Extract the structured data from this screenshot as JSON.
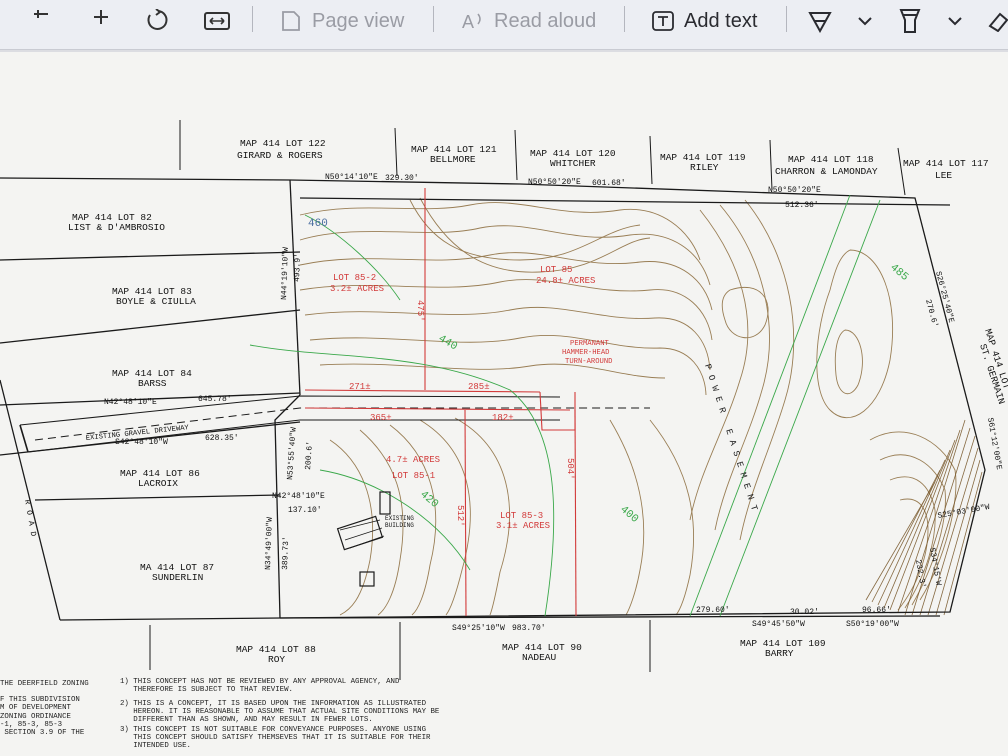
{
  "toolbar": {
    "page_view": "Page view",
    "read_aloud": "Read aloud",
    "add_text": "Add text"
  },
  "plan": {
    "adjacent": {
      "lot122": "MAP 414 LOT 122",
      "lot122_owner": "GIRARD & ROGERS",
      "lot121": "MAP 414 LOT 121",
      "lot121_owner": "BELLMORE",
      "lot120": "MAP 414 LOT 120",
      "lot120_owner": "WHITCHER",
      "lot119": "MAP 414 LOT 119",
      "lot119_owner": "RILEY",
      "lot118": "MAP 414 LOT 118",
      "lot118_owner": "CHARRON & LAMONDAY",
      "lot117": "MAP 414 LOT 117",
      "lot117_owner": "LEE",
      "lot82": "MAP 414 LOT 82",
      "lot82_owner": "LIST & D'AMBROSIO",
      "lot83": "MAP 414 LOT 83",
      "lot83_owner": "BOYLE & CIULLA",
      "lot84": "MAP 414 LOT 84",
      "lot84_owner": "BARSS",
      "lot86": "MAP 414 LOT 86",
      "lot86_owner": "LACROIX",
      "lot87": "MA 414 LOT 87",
      "lot87_owner": "SUNDERLIN",
      "lot88": "MAP 414 LOT 88",
      "lot88_owner": "ROY",
      "lot90": "MAP 414 LOT 90",
      "lot90_owner": "NADEAU",
      "lot109": "MAP 414 LOT 109",
      "lot109_owner": "BARRY",
      "right_lot": "MAP 414 LOT",
      "right_owner": "ST. GERMAIN"
    },
    "bearings": {
      "top1": "N50°14'10\"E",
      "top1_dist": "329.30'",
      "top2": "N50°50'20\"E",
      "top2_dist": "601.68'",
      "top3": "N50°50'20\"E",
      "top3_dist": "512.36'",
      "left_top": "N44°19'10\"W",
      "left_top_dist": "493.9'",
      "drive_n": "N42°48'10\"E",
      "drive_n_dist": "645.78'",
      "drive_s": "S42°48'10\"W",
      "drive_s_dist": "628.35'",
      "left_mid": "N53°55'40\"W",
      "left_mid_dist": "200.6'",
      "lot86_b": "N42°48'10\"E",
      "lot86_d": "137.10'",
      "left_low": "N34°49'00\"W",
      "left_low_dist": "389.73'",
      "bottom1": "S49°25'10\"W",
      "bottom1_dist": "983.70'",
      "bottom2": "S49°45'50\"W",
      "bottom2_dist": "279.60'",
      "bottom3": "S50°19'00\"W",
      "right1": "S26°25'40\"E",
      "right1_dist": "270.6'",
      "right2": "S61°12'00\"E",
      "right3": "S25°03'00\"W",
      "right4": "S34°15'W",
      "right4_dist": "232.3'",
      "bottom_small": "30.02'",
      "bottom_small2": "96.66'"
    },
    "lots": {
      "lot85_2": "LOT 85-2",
      "lot85_2_area": "3.2± ACRES",
      "lot85": "LOT 85",
      "lot85_area": "24.8± ACRES",
      "lot85_1": "LOT 85-1",
      "lot85_1_area": "4.7± ACRES",
      "lot85_3": "LOT 85-3",
      "lot85_3_area": "3.1± ACRES",
      "turnaround": "PERMANANT\nHAMMER-HEAD\nTURN-AROUND",
      "frontage1": "271±",
      "frontage2": "285±",
      "frontage3": "365±",
      "frontage4": "182±",
      "depth1": "475'",
      "depth2": "512'",
      "depth3": "504'"
    },
    "labels": {
      "driveway": "EXISTING GRAVEL DRIVEWAY",
      "building": "EXISTING\nBUILDING",
      "easement": "POWER EASEMENT",
      "road": "ROAD",
      "contour_460": "460",
      "contour_440": "440",
      "contour_420": "420",
      "contour_400": "400",
      "contour_485": "485"
    },
    "notes": [
      "1) THIS CONCEPT HAS NOT BE REVIEWED BY ANY APPROVAL AGENCY, AND\n   THEREFORE IS SUBJECT TO THAT REVIEW.",
      "2) THIS IS A CONCEPT, IT IS BASED UPON THE INFORMATION AS ILLUSTRATED\n   HEREON. IT IS REASONABLE TO ASSUME THAT ACTUAL SITE CONDITIONS MAY BE\n   DIFFERENT THAN AS SHOWN, AND MAY RESULT IN FEWER LOTS.",
      "3) THIS CONCEPT IS NOT SUITABLE FOR CONVEYANCE PURPOSES. ANYONE USING\n   THIS CONCEPT SHOULD SATISFY THEMSEVES THAT IT IS SUITABLE FOR THEIR\n   INTENDED USE."
    ],
    "side_note": "THE DEERFIELD ZONING\n\nF THIS SUBDIVISION\nM OF DEVELOPMENT\nZONING ORDINANCE\n-1, 85-3, 85-3\n SECTION 3.9 OF THE",
    "colors": {
      "boundary": "#1a1a1a",
      "lot_lines": "#d23a3a",
      "contours": "#8a6a3a",
      "green": "#3aa84a"
    }
  }
}
